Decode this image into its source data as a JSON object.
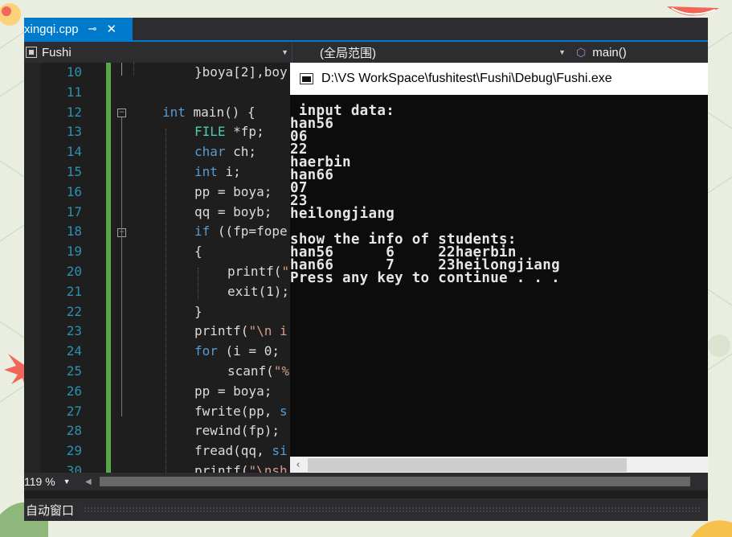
{
  "colors": {
    "accent": "#007acc",
    "editor_bg": "#1e1e1e",
    "keyword": "#569cd6",
    "string": "#d69d85",
    "line_number": "#2b91af",
    "change_bar": "#57a64a",
    "console_bg": "#0c0c0c"
  },
  "tab": {
    "filename": "xingqi.cpp",
    "pin_icon": "pin-icon",
    "close_icon": "close-icon"
  },
  "nav": {
    "project": "Fushi",
    "scope": "(全局范围)",
    "function": "main()"
  },
  "editor": {
    "line_numbers": [
      "10",
      "11",
      "12",
      "13",
      "14",
      "15",
      "16",
      "17",
      "18",
      "19",
      "20",
      "21",
      "22",
      "23",
      "24",
      "25",
      "26",
      "27",
      "28",
      "29",
      "30"
    ],
    "code": {
      "l10": "}boya[2],boy",
      "l12_kw": "int",
      "l12_rest": " main() {",
      "l13_ty": "FILE",
      "l13_rest": " *fp;",
      "l14_kw": "char",
      "l14_rest": " ch;",
      "l15_kw": "int",
      "l15_rest": " i;",
      "l16": "pp = boya;",
      "l17": "qq = boyb;",
      "l18_kw": "if",
      "l18_rest": " ((fp=fope",
      "l19": "{",
      "l20_a": "printf(",
      "l20_b": "\"",
      "l21": "exit(1);",
      "l22": "}",
      "l23_a": "printf(",
      "l23_b": "\"\\n i",
      "l24_kw": "for",
      "l24_rest": " (i = 0;",
      "l25_a": "scanf(",
      "l25_b": "\"%",
      "l26": "pp = boya;",
      "l27_a": "fwrite(pp, ",
      "l27_b": "s",
      "l28": "rewind(fp);",
      "l29_a": "fread(qq, ",
      "l29_b": "si",
      "l30_a": "printf(",
      "l30_b": "\"\\nsh"
    }
  },
  "status": {
    "zoom": "119 %"
  },
  "auto_window": {
    "label": "自动窗口"
  },
  "console": {
    "title": "D:\\VS WorkSpace\\fushitest\\Fushi\\Debug\\Fushi.exe",
    "lines": [
      " input data:",
      "han56",
      "06",
      "22",
      "haerbin",
      "han66",
      "07",
      "23",
      "heilongjiang",
      "",
      "show the info of students:",
      "han56      6     22haerbin",
      "han66      7     23heilongjiang",
      "Press any key to continue . . ."
    ]
  }
}
